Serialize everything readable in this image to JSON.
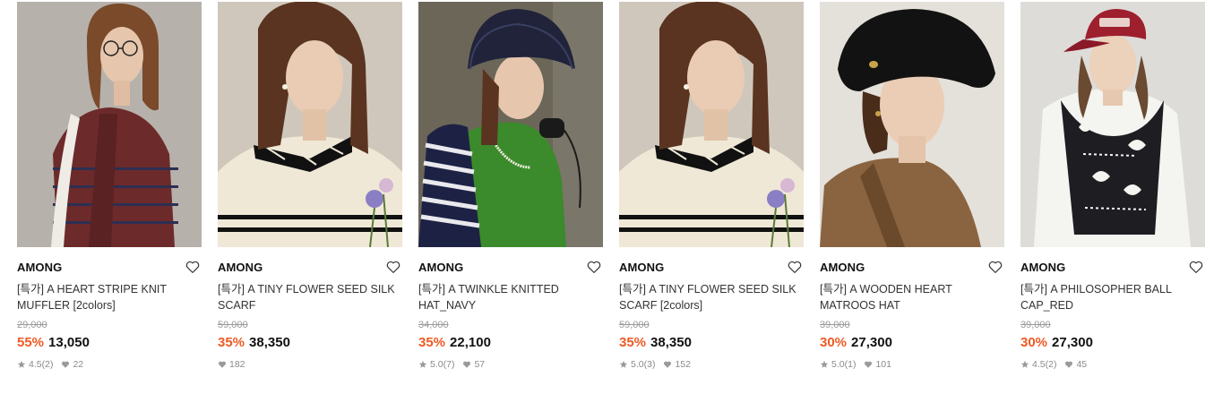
{
  "products": [
    {
      "brand": "AMONG",
      "title": "[특가] A HEART STRIPE KNIT MUFFLER [2colors]",
      "original_price": "29,000",
      "discount": "55%",
      "price": "13,050",
      "rating": "4.5",
      "reviews": "(2)",
      "likes": "22",
      "photo": {
        "bg": "#b9b5b0",
        "outfit": "#6d2a2a",
        "stripe": "#2d2f52",
        "hair": "#7a4a2a",
        "accessory": "glasses"
      }
    },
    {
      "brand": "AMONG",
      "title": "[특가] A TINY FLOWER SEED SILK SCARF",
      "original_price": "59,000",
      "discount": "35%",
      "price": "38,350",
      "rating": "",
      "reviews": "",
      "likes": "182",
      "photo": {
        "bg": "#c9c2b8",
        "outfit": "#efe8d6",
        "stripe": "#111111",
        "hair": "#5a3420",
        "accessory": "scarf"
      }
    },
    {
      "brand": "AMONG",
      "title": "[특가] A TWINKLE KNITTED HAT_NAVY",
      "original_price": "34,000",
      "discount": "35%",
      "price": "22,100",
      "rating": "5.0",
      "reviews": "(7)",
      "likes": "57",
      "photo": {
        "bg": "#6f6a5c",
        "outfit": "#3b8a2b",
        "stripe": "#1d2245",
        "hair": "#5a3420",
        "accessory": "bucket-hat"
      }
    },
    {
      "brand": "AMONG",
      "title": "[특가] A TINY FLOWER SEED SILK SCARF [2colors]",
      "original_price": "59,000",
      "discount": "35%",
      "price": "38,350",
      "rating": "5.0",
      "reviews": "(3)",
      "likes": "152",
      "photo": {
        "bg": "#c9c2b8",
        "outfit": "#efe8d6",
        "stripe": "#111111",
        "hair": "#5a3420",
        "accessory": "scarf"
      }
    },
    {
      "brand": "AMONG",
      "title": "[특가] A WOODEN HEART MATROOS HAT",
      "original_price": "39,000",
      "discount": "30%",
      "price": "27,300",
      "rating": "5.0",
      "reviews": "(1)",
      "likes": "101",
      "photo": {
        "bg": "#e3dfd9",
        "outfit": "#8a6440",
        "stripe": "#6b4a2c",
        "hair": "#4a2c1a",
        "accessory": "matroos-hat"
      }
    },
    {
      "brand": "AMONG",
      "title": "[특가] A PHILOSOPHER BALL CAP_RED",
      "original_price": "39,000",
      "discount": "30%",
      "price": "27,300",
      "rating": "4.5",
      "reviews": "(2)",
      "likes": "45",
      "photo": {
        "bg": "#dcdad6",
        "outfit": "#1d1d22",
        "stripe": "#f4f4f0",
        "hair": "#6a4a30",
        "accessory": "ball-cap"
      }
    }
  ],
  "colors": {
    "discount": "#ef5a24",
    "muted": "#8a8a8a"
  },
  "icons": {
    "wishlist": "heart-outline-icon",
    "rating": "star-icon",
    "likes": "heart-filled-icon"
  }
}
